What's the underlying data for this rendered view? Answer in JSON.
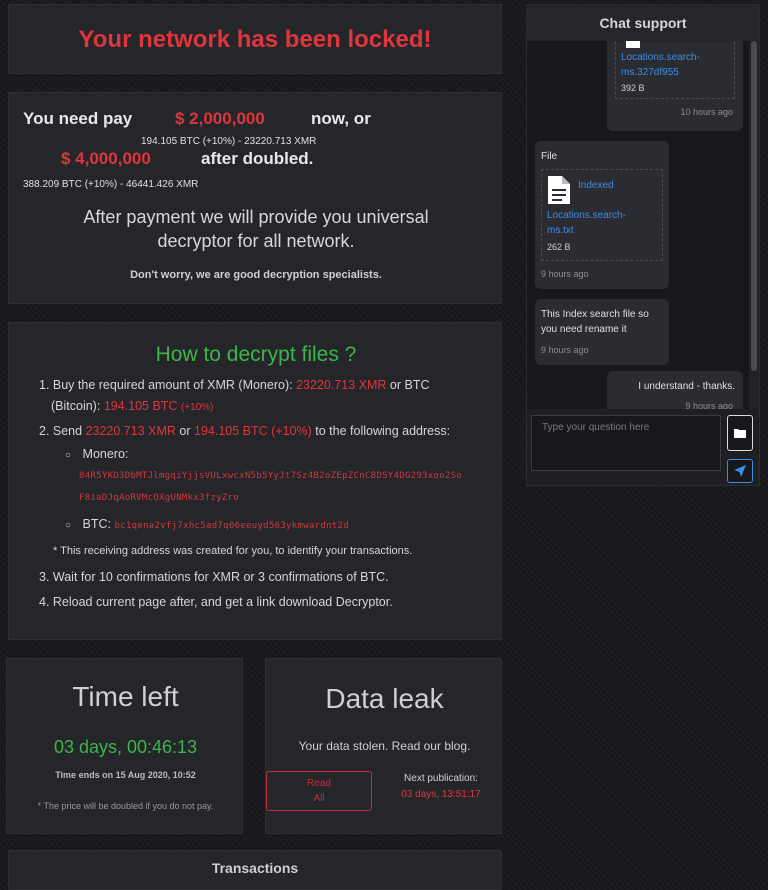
{
  "title": "Your network has been locked!",
  "payment": {
    "line1_prefix": "You need pay",
    "line1_amount": "$ 2,000,000",
    "line1_suffix": "now, or",
    "line1_crypto": "194.105 BTC (+10%) - 23220.713 XMR",
    "line2_amount": "$ 4,000,000",
    "line2_suffix": "after doubled.",
    "line2_crypto": "388.209 BTC (+10%) - 46441.426 XMR",
    "after_payment_1": "After payment we will provide you universal",
    "after_payment_2": "decryptor for all network.",
    "dont_worry": "Don't worry, we are good decryption specialists."
  },
  "howto": {
    "title": "How to decrypt files ?",
    "step1_a": "1. Buy the required amount of XMR (Monero):",
    "step1_xmr": "23220.713 XMR",
    "step1_b": "or BTC",
    "step1_c": "(Bitcoin):",
    "step1_btc": "194.105 BTC",
    "step1_btc_pct": "(+10%)",
    "step2_a": "2. Send",
    "step2_xmr": "23220.713 XMR",
    "step2_b": "or",
    "step2_btc": "194.105 BTC (+10%)",
    "step2_c": "to the following address:",
    "monero_label": "Monero:",
    "monero_addr_1": "84R5YKD3DbMTJlmgqiYjjsVULxwcxN5b5YyJt7Sz4B2oZEpZCnCBDSY4DG293xoo2So",
    "monero_addr_2": "F8iaDJqAoRVMcQXgUNMkx3fzyZro",
    "btc_label": "BTC:",
    "btc_addr": "bc1qena2vfj7xhc5ad7q06eeuyd563ykmwardnt2d",
    "note": "* This receiving address was created for you, to identify your transactions.",
    "step3": "3. Wait for 10 confirmations for XMR or 3 confirmations of BTC.",
    "step4": "4. Reload current page after, and get a link download Decryptor."
  },
  "timer": {
    "title": "Time left",
    "value": "03 days, 00:46:13",
    "ends": "Time ends on 15 Aug 2020, 10:52",
    "note": "* The price will be doubled if you do not pay."
  },
  "leak": {
    "title": "Data leak",
    "subtitle": "Your data stolen. Read our blog.",
    "read_line1": "Read",
    "read_line2": "All",
    "next_label": "Next publication:",
    "next_value": "03 days, 13:51:17"
  },
  "transactions": {
    "title": "Transactions"
  },
  "chat": {
    "title": "Chat support",
    "msg1": {
      "file_line1": "Locations.search-",
      "file_line2": "ms.327df955",
      "size": "392 B",
      "time": "10 hours ago"
    },
    "msg2": {
      "label": "File",
      "file_line1": "Indexed",
      "file_line2": "Locations.search-",
      "file_line3": "ms.txt",
      "size": "262 B",
      "time": "9 hours ago"
    },
    "msg3": {
      "line1": "This Index search file so",
      "line2": "you need rename it",
      "time": "9 hours ago"
    },
    "msg4": {
      "text": "I understand - thanks.",
      "time": "9 hours ago"
    },
    "input_placeholder": "Type your question here",
    "accent": "#3a8ee6"
  },
  "colors": {
    "red": "#e0353c",
    "green": "#3db54a",
    "link": "#3a8ee6"
  }
}
